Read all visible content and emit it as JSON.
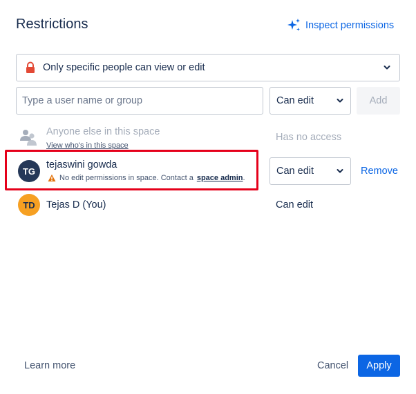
{
  "header": {
    "title": "Restrictions",
    "inspect_label": "Inspect permissions"
  },
  "restriction_select": {
    "value": "Only specific people can view or edit",
    "icon": "lock-icon"
  },
  "add_user": {
    "placeholder": "Type a user name or group",
    "permission_value": "Can edit",
    "add_label": "Add"
  },
  "everyone_row": {
    "name": "Anyone else in this space",
    "link": "View who's in this space",
    "access": "Has no access"
  },
  "users": [
    {
      "initials": "TG",
      "name": "tejaswini gowda",
      "warning_text": "No edit permissions in space. Contact a",
      "warning_link": "space admin",
      "warning_suffix": ".",
      "permission": "Can edit",
      "remove_label": "Remove"
    },
    {
      "initials": "TD",
      "name": "Tejas D (You)",
      "permission": "Can edit"
    }
  ],
  "footer": {
    "learn_more": "Learn more",
    "cancel": "Cancel",
    "apply": "Apply"
  },
  "colors": {
    "accent": "#0c66e4",
    "highlight": "#e5001a",
    "lock": "#e34935",
    "warning": "#e2730b",
    "avatar_tg": "#253858",
    "avatar_td": "#f6a022"
  }
}
